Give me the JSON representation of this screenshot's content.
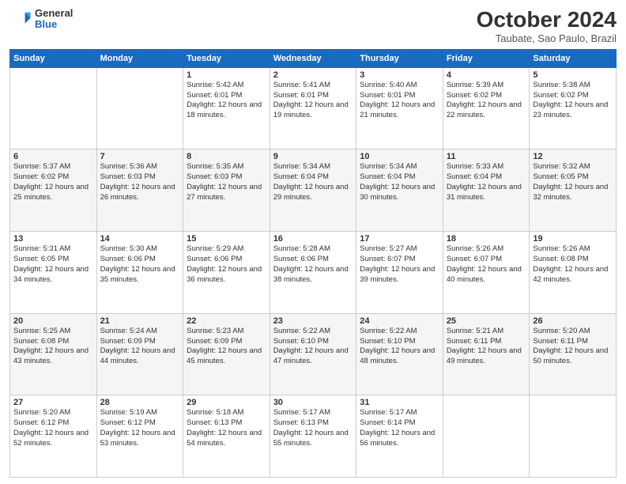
{
  "logo": {
    "general": "General",
    "blue": "Blue"
  },
  "header": {
    "title": "October 2024",
    "subtitle": "Taubate, Sao Paulo, Brazil"
  },
  "weekdays": [
    "Sunday",
    "Monday",
    "Tuesday",
    "Wednesday",
    "Thursday",
    "Friday",
    "Saturday"
  ],
  "weeks": [
    [
      {
        "day": "",
        "detail": ""
      },
      {
        "day": "",
        "detail": ""
      },
      {
        "day": "1",
        "detail": "Sunrise: 5:42 AM\nSunset: 6:01 PM\nDaylight: 12 hours\nand 18 minutes."
      },
      {
        "day": "2",
        "detail": "Sunrise: 5:41 AM\nSunset: 6:01 PM\nDaylight: 12 hours\nand 19 minutes."
      },
      {
        "day": "3",
        "detail": "Sunrise: 5:40 AM\nSunset: 6:01 PM\nDaylight: 12 hours\nand 21 minutes."
      },
      {
        "day": "4",
        "detail": "Sunrise: 5:39 AM\nSunset: 6:02 PM\nDaylight: 12 hours\nand 22 minutes."
      },
      {
        "day": "5",
        "detail": "Sunrise: 5:38 AM\nSunset: 6:02 PM\nDaylight: 12 hours\nand 23 minutes."
      }
    ],
    [
      {
        "day": "6",
        "detail": "Sunrise: 5:37 AM\nSunset: 6:02 PM\nDaylight: 12 hours\nand 25 minutes."
      },
      {
        "day": "7",
        "detail": "Sunrise: 5:36 AM\nSunset: 6:03 PM\nDaylight: 12 hours\nand 26 minutes."
      },
      {
        "day": "8",
        "detail": "Sunrise: 5:35 AM\nSunset: 6:03 PM\nDaylight: 12 hours\nand 27 minutes."
      },
      {
        "day": "9",
        "detail": "Sunrise: 5:34 AM\nSunset: 6:04 PM\nDaylight: 12 hours\nand 29 minutes."
      },
      {
        "day": "10",
        "detail": "Sunrise: 5:34 AM\nSunset: 6:04 PM\nDaylight: 12 hours\nand 30 minutes."
      },
      {
        "day": "11",
        "detail": "Sunrise: 5:33 AM\nSunset: 6:04 PM\nDaylight: 12 hours\nand 31 minutes."
      },
      {
        "day": "12",
        "detail": "Sunrise: 5:32 AM\nSunset: 6:05 PM\nDaylight: 12 hours\nand 32 minutes."
      }
    ],
    [
      {
        "day": "13",
        "detail": "Sunrise: 5:31 AM\nSunset: 6:05 PM\nDaylight: 12 hours\nand 34 minutes."
      },
      {
        "day": "14",
        "detail": "Sunrise: 5:30 AM\nSunset: 6:06 PM\nDaylight: 12 hours\nand 35 minutes."
      },
      {
        "day": "15",
        "detail": "Sunrise: 5:29 AM\nSunset: 6:06 PM\nDaylight: 12 hours\nand 36 minutes."
      },
      {
        "day": "16",
        "detail": "Sunrise: 5:28 AM\nSunset: 6:06 PM\nDaylight: 12 hours\nand 38 minutes."
      },
      {
        "day": "17",
        "detail": "Sunrise: 5:27 AM\nSunset: 6:07 PM\nDaylight: 12 hours\nand 39 minutes."
      },
      {
        "day": "18",
        "detail": "Sunrise: 5:26 AM\nSunset: 6:07 PM\nDaylight: 12 hours\nand 40 minutes."
      },
      {
        "day": "19",
        "detail": "Sunrise: 5:26 AM\nSunset: 6:08 PM\nDaylight: 12 hours\nand 42 minutes."
      }
    ],
    [
      {
        "day": "20",
        "detail": "Sunrise: 5:25 AM\nSunset: 6:08 PM\nDaylight: 12 hours\nand 43 minutes."
      },
      {
        "day": "21",
        "detail": "Sunrise: 5:24 AM\nSunset: 6:09 PM\nDaylight: 12 hours\nand 44 minutes."
      },
      {
        "day": "22",
        "detail": "Sunrise: 5:23 AM\nSunset: 6:09 PM\nDaylight: 12 hours\nand 45 minutes."
      },
      {
        "day": "23",
        "detail": "Sunrise: 5:22 AM\nSunset: 6:10 PM\nDaylight: 12 hours\nand 47 minutes."
      },
      {
        "day": "24",
        "detail": "Sunrise: 5:22 AM\nSunset: 6:10 PM\nDaylight: 12 hours\nand 48 minutes."
      },
      {
        "day": "25",
        "detail": "Sunrise: 5:21 AM\nSunset: 6:11 PM\nDaylight: 12 hours\nand 49 minutes."
      },
      {
        "day": "26",
        "detail": "Sunrise: 5:20 AM\nSunset: 6:11 PM\nDaylight: 12 hours\nand 50 minutes."
      }
    ],
    [
      {
        "day": "27",
        "detail": "Sunrise: 5:20 AM\nSunset: 6:12 PM\nDaylight: 12 hours\nand 52 minutes."
      },
      {
        "day": "28",
        "detail": "Sunrise: 5:19 AM\nSunset: 6:12 PM\nDaylight: 12 hours\nand 53 minutes."
      },
      {
        "day": "29",
        "detail": "Sunrise: 5:18 AM\nSunset: 6:13 PM\nDaylight: 12 hours\nand 54 minutes."
      },
      {
        "day": "30",
        "detail": "Sunrise: 5:17 AM\nSunset: 6:13 PM\nDaylight: 12 hours\nand 55 minutes."
      },
      {
        "day": "31",
        "detail": "Sunrise: 5:17 AM\nSunset: 6:14 PM\nDaylight: 12 hours\nand 56 minutes."
      },
      {
        "day": "",
        "detail": ""
      },
      {
        "day": "",
        "detail": ""
      }
    ]
  ]
}
